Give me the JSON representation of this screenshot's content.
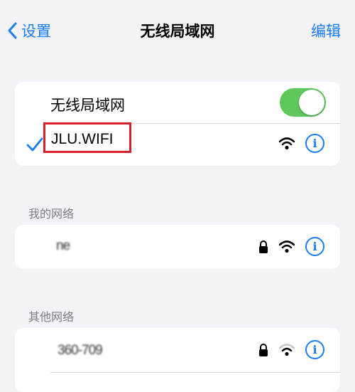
{
  "nav": {
    "back_label": "设置",
    "title": "无线局域网",
    "edit_label": "编辑"
  },
  "wlan": {
    "toggle_label": "无线局域网",
    "toggle_on": true,
    "connected_network": "JLU.WIFI"
  },
  "my_networks": {
    "header": "我的网络",
    "items": [
      {
        "name": "ne",
        "locked": true
      }
    ]
  },
  "other_networks": {
    "header": "其他网络",
    "items": [
      {
        "name": "360-709",
        "locked": true
      }
    ]
  },
  "colors": {
    "accent": "#1a7cf5",
    "toggle_on": "#5fc85d",
    "highlight_box": "#d8212a",
    "background": "#f2f2f7"
  }
}
